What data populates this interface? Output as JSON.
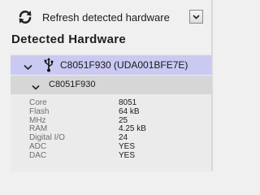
{
  "toolbar": {
    "refresh_label": "Refresh detected hardware",
    "refresh_icon": "refresh-icon",
    "dropdown_icon": "chevron-down-icon"
  },
  "section": {
    "title": "Detected Hardware"
  },
  "tree": {
    "device": {
      "label": "C8051F930 (UDA001BFE7E)",
      "icon": "usb-icon",
      "expanded": true
    },
    "chip": {
      "label": "C8051F930",
      "expanded": true
    },
    "properties": [
      {
        "key": "Core",
        "value": "8051"
      },
      {
        "key": "Flash",
        "value": "64 kB"
      },
      {
        "key": "MHz",
        "value": "25"
      },
      {
        "key": "RAM",
        "value": "4.25 kB"
      },
      {
        "key": "Digital I/O",
        "value": "24"
      },
      {
        "key": "ADC",
        "value": "YES"
      },
      {
        "key": "DAC",
        "value": "YES"
      }
    ]
  },
  "colors": {
    "selected_row": "#c9c9f2",
    "sub_row": "#d6d6d6",
    "background": "#f0f0f0",
    "key_text": "#6e6e6e"
  }
}
